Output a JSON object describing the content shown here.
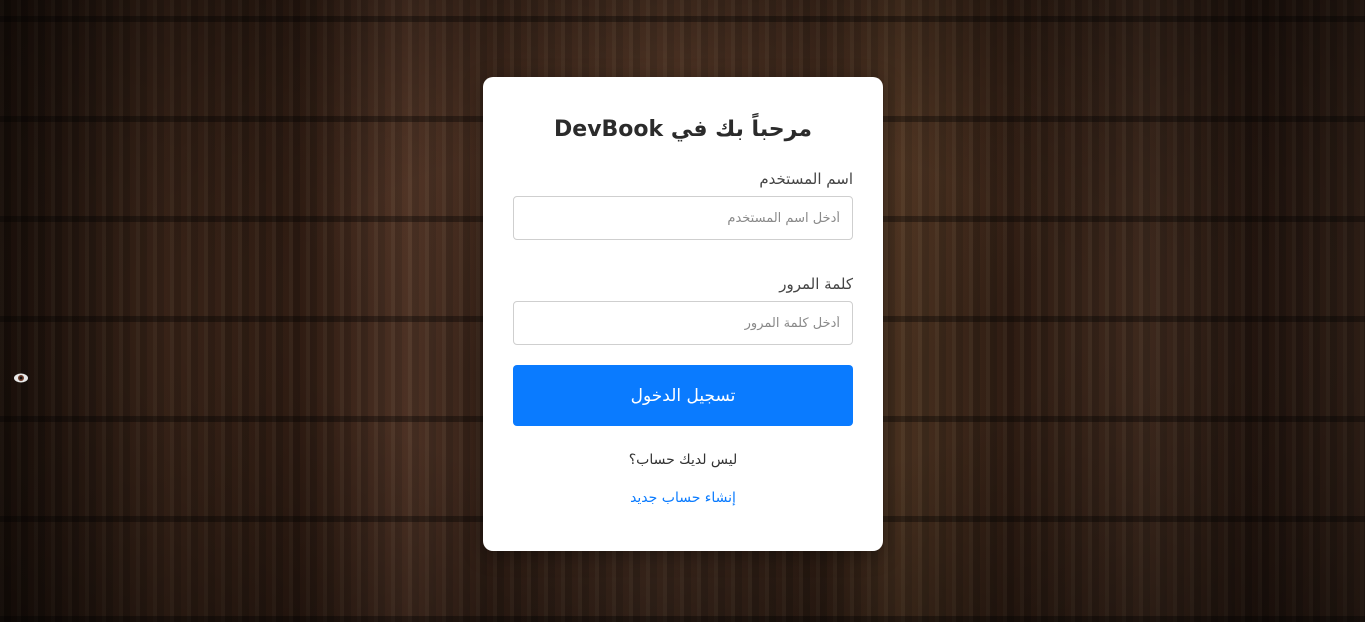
{
  "login": {
    "title": "مرحباً بك في DevBook",
    "username_label": "اسم المستخدم",
    "username_placeholder": "أدخل اسم المستخدم",
    "username_value": "",
    "password_label": "كلمة المرور",
    "password_placeholder": "أدخل كلمة المرور",
    "password_value": "",
    "submit_label": "تسجيل الدخول",
    "no_account_text": "ليس لديك حساب؟",
    "register_link": "إنشاء حساب جديد"
  },
  "colors": {
    "accent": "#0a7bff",
    "card_bg": "#ffffff"
  },
  "icons": {
    "edge_icon": "eye-icon"
  }
}
